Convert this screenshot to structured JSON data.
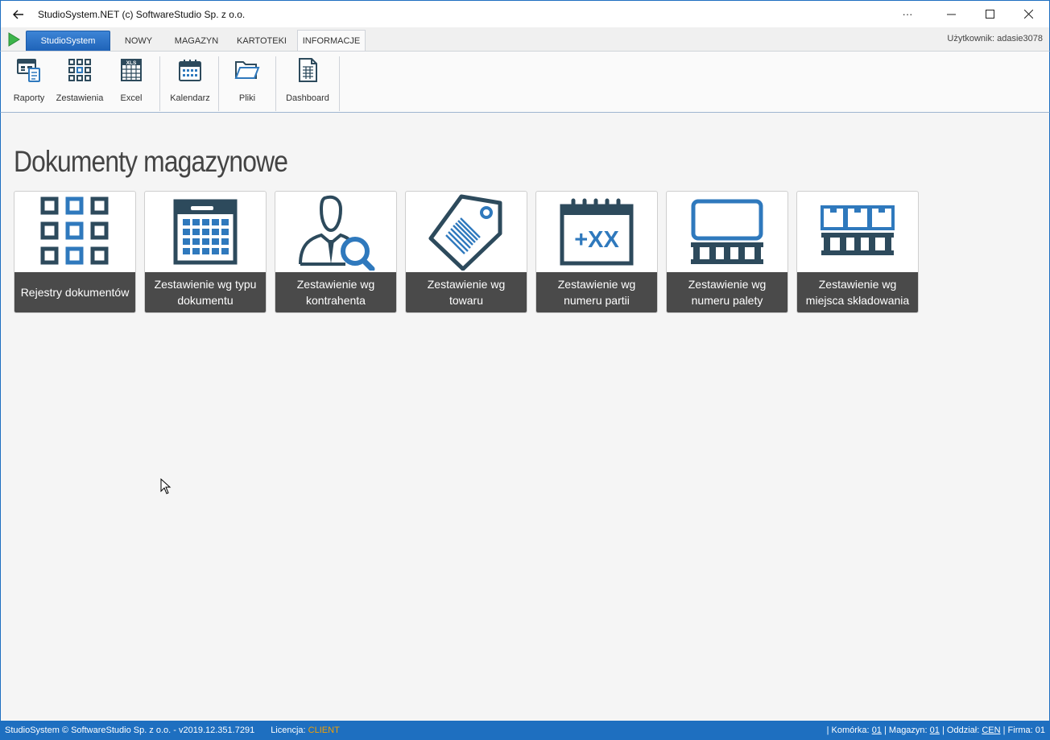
{
  "window": {
    "title": "StudioSystem.NET (c) SoftwareStudio Sp. z o.o.",
    "more": "···",
    "minimize": "—",
    "maximize": "☐",
    "close": "✕"
  },
  "tabs": {
    "app": "StudioSystem",
    "items": [
      "NOWY",
      "MAGAZYN",
      "KARTOTEKI",
      "INFORMACJE"
    ],
    "active": "INFORMACJE",
    "user": "Użytkownik: adasie3078"
  },
  "ribbon": {
    "raporty": "Raporty",
    "zestawienia": "Zestawienia",
    "excel": "Excel",
    "kalendarz": "Kalendarz",
    "pliki": "Pliki",
    "dashboard": "Dashboard",
    "excel_badge": "XLS"
  },
  "main": {
    "heading": "Dokumenty magazynowe",
    "tiles": [
      {
        "label": "Rejestry dokumentów",
        "icon": "grid-icon"
      },
      {
        "label": "Zestawienie wg typu dokumentu",
        "icon": "calendar-table-icon"
      },
      {
        "label": "Zestawienie wg kontrahenta",
        "icon": "person-search-icon"
      },
      {
        "label": "Zestawienie wg towaru",
        "icon": "price-tag-icon"
      },
      {
        "label": "Zestawienie wg numeru partii",
        "icon": "batch-calendar-icon",
        "badge": "+XX"
      },
      {
        "label": "Zestawienie wg numeru palety",
        "icon": "pallet-icon"
      },
      {
        "label": "Zestawienie wg miejsca składowania",
        "icon": "storage-pallet-icon"
      }
    ]
  },
  "status": {
    "copyright": "StudioSystem © SoftwareStudio Sp. z o.o. - v2019.12.351.7291",
    "license_label": "Licencja:",
    "license_value": "CLIENT",
    "komorka_label": "| Komórka:",
    "komorka": "01",
    "magazyn_label": "| Magazyn:",
    "magazyn": "01",
    "oddzial_label": "| Oddział:",
    "oddzial": "CEN",
    "firma": "| Firma: 01"
  },
  "colors": {
    "accent": "#1e6fc0",
    "icon_dark": "#2d4a5c",
    "icon_blue": "#2f79bd",
    "tile_label_bg": "#4a4a4a"
  }
}
